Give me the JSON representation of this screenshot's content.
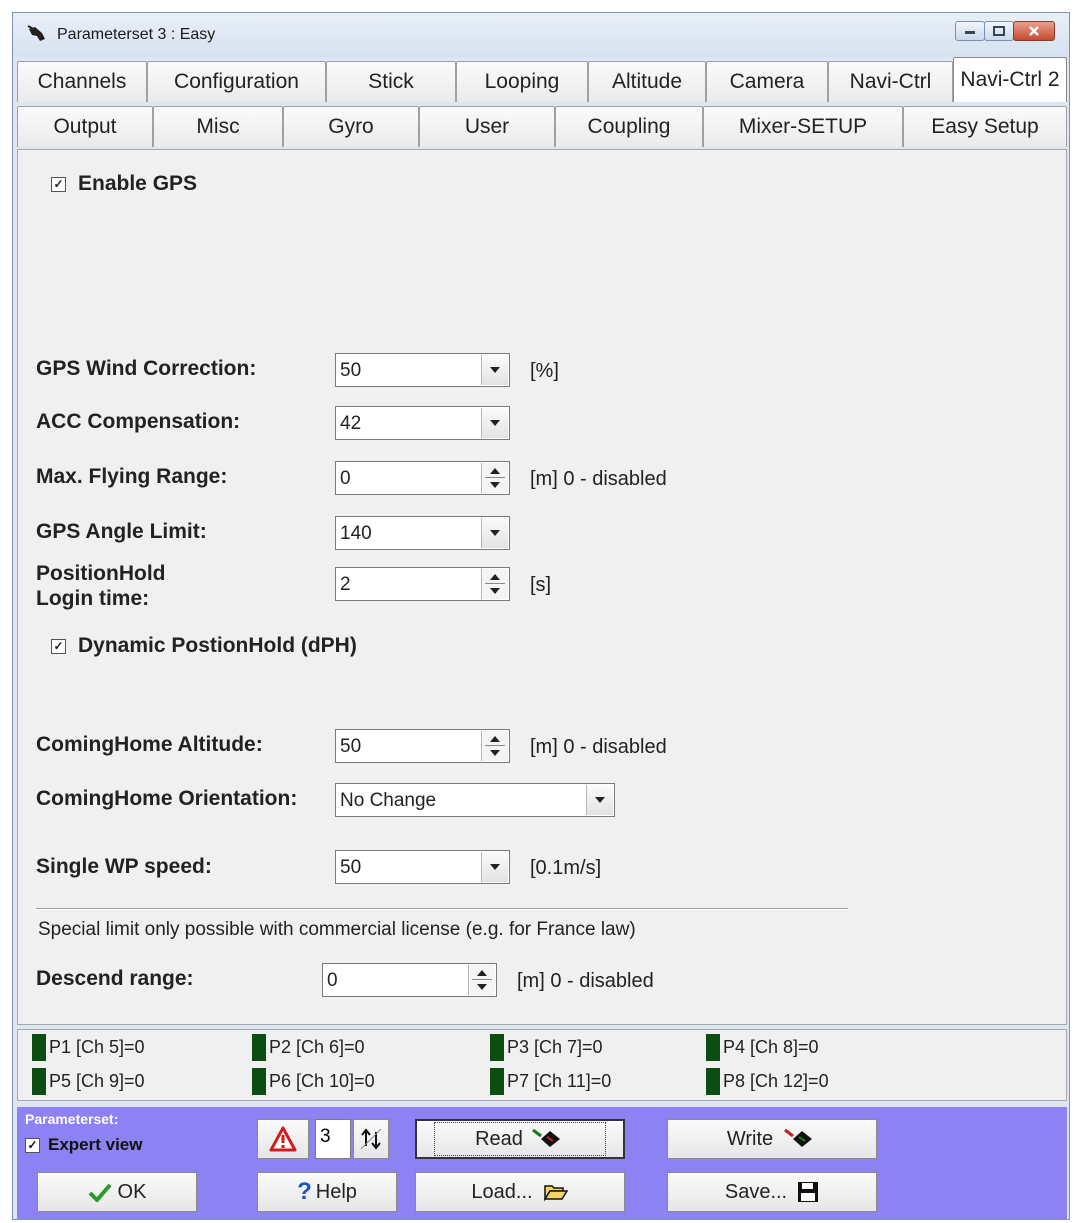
{
  "window": {
    "title": "Parameterset 3 : Easy"
  },
  "tabs_row1": [
    "Channels",
    "Configuration",
    "Stick",
    "Looping",
    "Altitude",
    "Camera",
    "Navi-Ctrl",
    "Navi-Ctrl 2"
  ],
  "tabs_row2": [
    "Output",
    "Misc",
    "Gyro",
    "User",
    "Coupling",
    "Mixer-SETUP",
    "Easy Setup"
  ],
  "active_tab": "Navi-Ctrl 2",
  "form": {
    "enable_gps": {
      "label": "Enable GPS",
      "checked": true
    },
    "wind_correction": {
      "label": "GPS Wind Correction:",
      "value": "50",
      "unit": "[%]"
    },
    "acc_compensation": {
      "label": "ACC Compensation:",
      "value": "42"
    },
    "max_flying_range": {
      "label": "Max. Flying Range:",
      "value": "0",
      "unit": "[m]  0 - disabled"
    },
    "gps_angle_limit": {
      "label": "GPS Angle Limit:",
      "value": "140"
    },
    "positionhold_login": {
      "label_line1": "PositionHold",
      "label_line2": "Login time:",
      "value": "2",
      "unit": "[s]"
    },
    "dynamic_positionhold": {
      "label": "Dynamic PostionHold (dPH)",
      "checked": true
    },
    "cominghome_altitude": {
      "label": "ComingHome Altitude:",
      "value": "50",
      "unit": "[m]  0 - disabled"
    },
    "cominghome_orientation": {
      "label": "ComingHome Orientation:",
      "value": "No Change"
    },
    "single_wp_speed": {
      "label": "Single WP speed:",
      "value": "50",
      "unit": "[0.1m/s]"
    },
    "special_limit_note": "Special limit only possible with commercial license (e.g. for France law)",
    "descend_range": {
      "label": "Descend range:",
      "value": "0",
      "unit": "[m]  0 - disabled"
    }
  },
  "channels": [
    "P1 [Ch 5]=0",
    "P2 [Ch 6]=0",
    "P3 [Ch 7]=0",
    "P4 [Ch 8]=0",
    "P5 [Ch 9]=0",
    "P6 [Ch 10]=0",
    "P7 [Ch 11]=0",
    "P8 [Ch 12]=0"
  ],
  "bottom": {
    "parameterset_label": "Parameterset:",
    "expert_view": "Expert view",
    "parameterset_number": "3",
    "read": "Read",
    "write": "Write",
    "ok": "OK",
    "help": "Help",
    "load": "Load...",
    "save": "Save..."
  },
  "colors": {
    "bottom_bar": "#8d82f3",
    "led": "#0c4d12",
    "panel": "#f0f0f0"
  }
}
